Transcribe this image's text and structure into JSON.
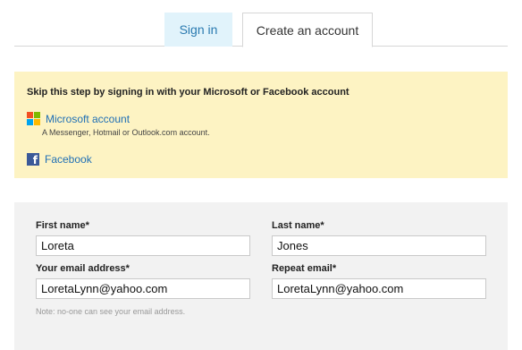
{
  "tabs": {
    "sign_in": "Sign in",
    "create_account": "Create an account"
  },
  "social": {
    "title": "Skip this step by signing in with your Microsoft or Facebook account",
    "microsoft_label": "Microsoft account",
    "microsoft_desc": "A Messenger, Hotmail or Outlook.com account.",
    "facebook_label": "Facebook",
    "microsoft_logo_colors": [
      "#f25022",
      "#7fba00",
      "#00a4ef",
      "#ffb900"
    ],
    "facebook_color": "#3b5998"
  },
  "form": {
    "first_name_label": "First name*",
    "first_name_value": "Loreta",
    "last_name_label": "Last name*",
    "last_name_value": "Jones",
    "email_label": "Your email address*",
    "email_value": "LoretaLynn@yahoo.com",
    "repeat_email_label": "Repeat email*",
    "repeat_email_value": "LoretaLynn@yahoo.com",
    "note": "Note: no-one can see your email address."
  }
}
